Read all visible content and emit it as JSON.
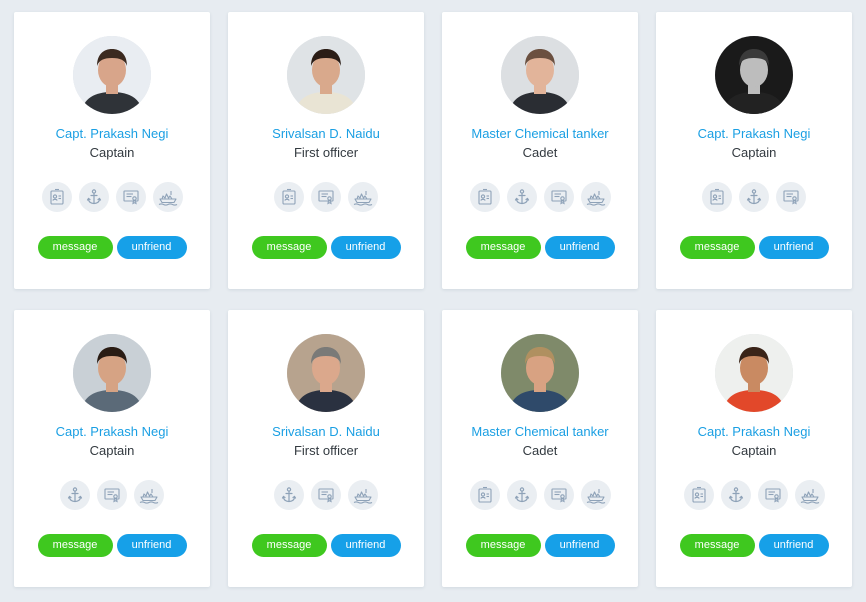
{
  "colors": {
    "background": "#e7ecf1",
    "card": "#ffffff",
    "name": "#1a9fe3",
    "role": "#333a40",
    "message_button": "#3fc81f",
    "unfriend_button": "#16a0e8",
    "icon_bg": "#eaeef2",
    "icon_stroke": "#8ea2b8"
  },
  "cards": [
    {
      "name": "Capt. Prakash Negi",
      "role": "Captain",
      "icons": [
        "id-card-icon",
        "anchor-icon",
        "certificate-icon",
        "ship-icon"
      ],
      "message_label": "message",
      "unfriend_label": "unfriend",
      "avatar": {
        "bg": "#e9edf2",
        "skin": "#d8a58a",
        "hair": "#3b2a20",
        "shirt": "#2f3338"
      }
    },
    {
      "name": "Srivalsan D. Naidu",
      "role": "First officer",
      "icons": [
        "id-card-icon",
        "certificate-icon",
        "ship-icon"
      ],
      "message_label": "message",
      "unfriend_label": "unfriend",
      "avatar": {
        "bg": "#dfe3e6",
        "skin": "#d9a98c",
        "hair": "#2b1d16",
        "shirt": "#e9e4d4"
      }
    },
    {
      "name": "Master Chemical tanker",
      "role": "Cadet",
      "icons": [
        "id-card-icon",
        "anchor-icon",
        "certificate-icon",
        "ship-icon"
      ],
      "message_label": "message",
      "unfriend_label": "unfriend",
      "avatar": {
        "bg": "#dcdfe2",
        "skin": "#e2b49a",
        "hair": "#6b5040",
        "shirt": "#2a2d33"
      }
    },
    {
      "name": "Capt. Prakash Negi",
      "role": "Captain",
      "icons": [
        "id-card-icon",
        "anchor-icon",
        "certificate-icon"
      ],
      "message_label": "message",
      "unfriend_label": "unfriend",
      "avatar": {
        "bg": "#1a1a1a",
        "skin": "#bdbdbd",
        "hair": "#3a3a3a",
        "shirt": "#222222"
      }
    },
    {
      "name": "Capt. Prakash Negi",
      "role": "Captain",
      "icons": [
        "anchor-icon",
        "certificate-icon",
        "ship-icon"
      ],
      "message_label": "message",
      "unfriend_label": "unfriend",
      "avatar": {
        "bg": "#c9d0d6",
        "skin": "#d6a384",
        "hair": "#2a1c14",
        "shirt": "#5b6a78"
      }
    },
    {
      "name": "Srivalsan D. Naidu",
      "role": "First officer",
      "icons": [
        "anchor-icon",
        "certificate-icon",
        "ship-icon"
      ],
      "message_label": "message",
      "unfriend_label": "unfriend",
      "avatar": {
        "bg": "#b7a38e",
        "skin": "#dba88c",
        "hair": "#7a7a78",
        "shirt": "#2a3140"
      }
    },
    {
      "name": "Master Chemical tanker",
      "role": "Cadet",
      "icons": [
        "id-card-icon",
        "anchor-icon",
        "certificate-icon",
        "ship-icon"
      ],
      "message_label": "message",
      "unfriend_label": "unfriend",
      "avatar": {
        "bg": "#7f8a6a",
        "skin": "#d8a282",
        "hair": "#b09060",
        "shirt": "#2f4a6a"
      }
    },
    {
      "name": "Capt. Prakash Negi",
      "role": "Captain",
      "icons": [
        "id-card-icon",
        "anchor-icon",
        "certificate-icon",
        "ship-icon"
      ],
      "message_label": "message",
      "unfriend_label": "unfriend",
      "avatar": {
        "bg": "#eef0ee",
        "skin": "#c98a62",
        "hair": "#3a2418",
        "shirt": "#e2482a"
      }
    }
  ]
}
